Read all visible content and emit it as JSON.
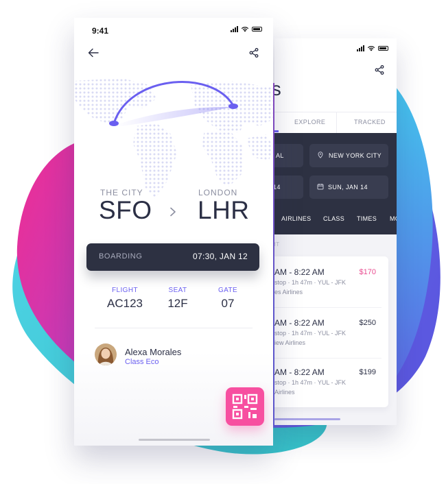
{
  "colors": {
    "accent": "#6a5ff0",
    "dark": "#2d3142",
    "pink": "#f74fa0",
    "price_highlight": "#e94d91"
  },
  "front": {
    "status_time": "9:41",
    "icons": {
      "back": "arrow-left-icon",
      "share": "share-icon",
      "qr": "qr-code-icon"
    },
    "origin": {
      "city": "THE CITY",
      "code": "SFO"
    },
    "destination": {
      "city": "LONDON",
      "code": "LHR"
    },
    "boarding": {
      "label": "BOARDING",
      "value": "07:30, JAN 12"
    },
    "info": [
      {
        "label": "FLIGHT",
        "value": "AC123"
      },
      {
        "label": "SEAT",
        "value": "12F"
      },
      {
        "label": "GATE",
        "value": "07"
      }
    ],
    "passenger": {
      "name": "Alexa Morales",
      "class": "Class Eco"
    }
  },
  "back": {
    "title_fragment": "ts",
    "tabs": [
      {
        "label": "EXPLORE"
      },
      {
        "label": "TRACKED"
      }
    ],
    "fields": {
      "from_fragment": "AL",
      "to": "NEW YORK CITY",
      "date_left_fragment": "14",
      "date_right": "SUN, JAN 14"
    },
    "filters": [
      "AIRLINES",
      "CLASS",
      "TIMES",
      "MO"
    ],
    "section_fragment": "HT",
    "flights": [
      {
        "time": "AM - 8:22 AM",
        "detail": "stop · 1h 47m · YUL - JFK",
        "airline": "es Airlines",
        "price": "$170"
      },
      {
        "time": "AM - 8:22 AM",
        "detail": "stop · 1h 47m · YUL - JFK",
        "airline": "iew Airlines",
        "price": "$250"
      },
      {
        "time": "AM - 8:22 AM",
        "detail": "stop · 1h 47m · YUL - JFK",
        "airline": "Airlines",
        "price": "$199"
      }
    ]
  }
}
